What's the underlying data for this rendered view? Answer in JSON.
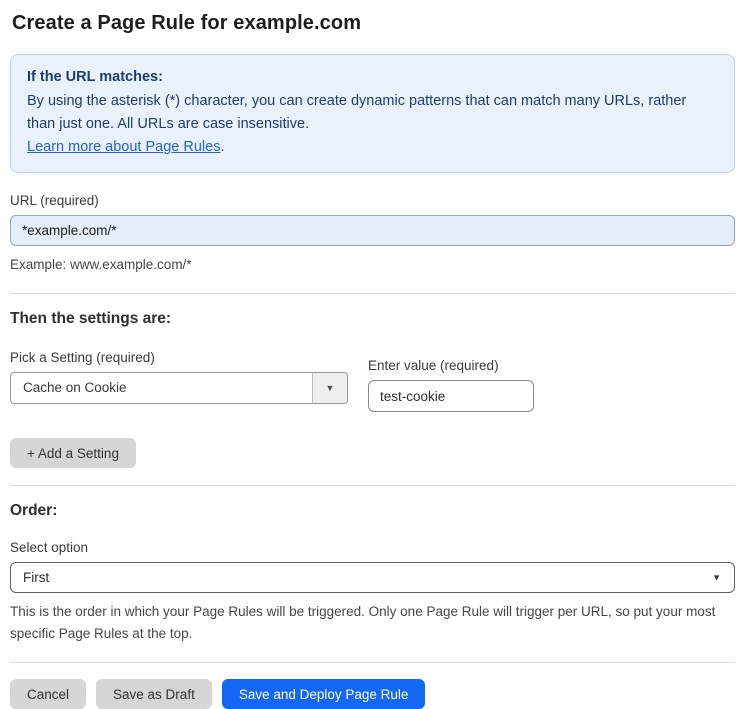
{
  "page": {
    "title": "Create a Page Rule for example.com"
  },
  "info_box": {
    "heading": "If the URL matches:",
    "body": "By using the asterisk (*) character, you can create dynamic patterns that can match many URLs, rather than just one. All URLs are case insensitive.",
    "link_label": "Learn more about Page Rules",
    "link_suffix": "."
  },
  "url_field": {
    "label": "URL (required)",
    "value": "*example.com/*",
    "helper": "Example: www.example.com/*"
  },
  "settings_section": {
    "heading": "Then the settings are:",
    "setting_picker": {
      "label": "Pick a Setting (required)",
      "selected": "Cache on Cookie"
    },
    "value_field": {
      "label": "Enter value (required)",
      "value": "test-cookie"
    },
    "add_setting_label": "+ Add a Setting"
  },
  "order_section": {
    "heading": "Order:",
    "select_label": "Select option",
    "selected": "First",
    "helper": "This is the order in which your Page Rules will be triggered. Only one Page Rule will trigger per URL, so put your most specific Page Rules at the top."
  },
  "footer": {
    "cancel_label": "Cancel",
    "save_draft_label": "Save as Draft",
    "save_deploy_label": "Save and Deploy Page Rule"
  },
  "colors": {
    "accent_blue": "#1467f2",
    "info_bg": "#e9f1fb",
    "info_border": "#b8d4f1",
    "info_text": "#1e3c6e",
    "link_blue": "#2563c9",
    "url_input_bg": "#e4edfa",
    "button_gray": "#d6d6d6"
  },
  "icons": {
    "dropdown_arrow": "▼"
  }
}
